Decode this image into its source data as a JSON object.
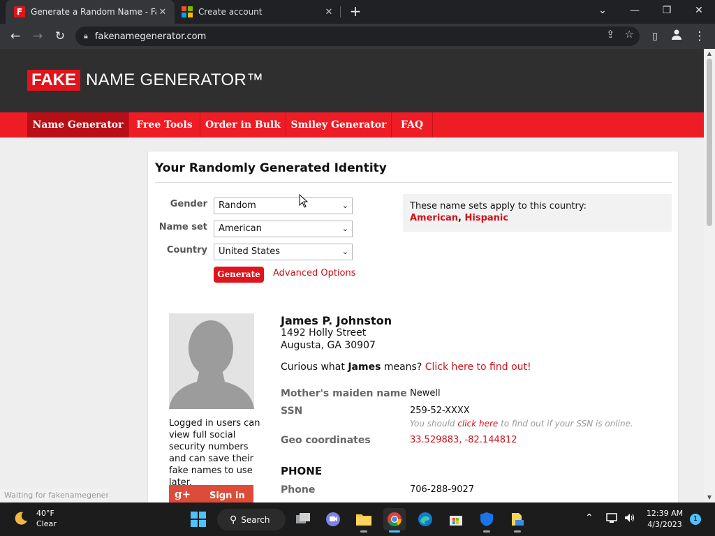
{
  "browser": {
    "tabs": [
      {
        "title": "Generate a Random Name - Fake Name Generator",
        "close": "✕"
      },
      {
        "title": "Create account",
        "close": "✕"
      }
    ],
    "new_tab": "+",
    "window_controls": {
      "tab_search": "⌄",
      "minimize": "—",
      "restore": "❐",
      "close": "✕"
    },
    "url": "fakenamegenerator.com"
  },
  "site": {
    "logo_fake": "FAKE",
    "logo_rest": "NAME GENERATOR™",
    "nav": [
      "Name Generator",
      "Free Tools",
      "Order in Bulk",
      "Smiley Generator",
      "FAQ"
    ]
  },
  "form": {
    "heading": "Your Randomly Generated Identity",
    "gender_label": "Gender",
    "gender_value": "Random",
    "nameset_label": "Name set",
    "nameset_value": "American",
    "country_label": "Country",
    "country_value": "United States",
    "generate": "Generate",
    "advanced": "Advanced Options",
    "nameset_info": "These name sets apply to this country:",
    "nameset_link1": "American",
    "nameset_sep": ", ",
    "nameset_link2": "Hispanic"
  },
  "identity": {
    "name": "James P. Johnston",
    "street": "1492 Holly Street",
    "city": "Augusta, GA 30907",
    "curious_pre": "Curious what ",
    "curious_name": "James",
    "curious_mid": " means? ",
    "curious_link": "Click here to find out!",
    "side_note": "Logged in users can view full social security numbers and can save their fake names to use later.",
    "gplus_icon": "g+",
    "gplus_label": "Sign in",
    "rows": {
      "maiden_label": "Mother's maiden name",
      "maiden_value": "Newell",
      "ssn_label": "SSN",
      "ssn_value": "259-52-XXXX",
      "ssn_note_pre": "You should ",
      "ssn_note_link": "click here",
      "ssn_note_post": " to find out if your SSN is online.",
      "geo_label": "Geo coordinates",
      "geo_value": "33.529883, -82.144812"
    },
    "phone_section": "PHONE",
    "phone_label": "Phone",
    "phone_value": "706-288-9027"
  },
  "status_bar": "Waiting for fakenamegenerator...",
  "taskbar": {
    "temp": "40°F",
    "condition": "Clear",
    "search": "Search",
    "time": "12:39 AM",
    "date": "4/3/2023",
    "notifications": "1"
  }
}
